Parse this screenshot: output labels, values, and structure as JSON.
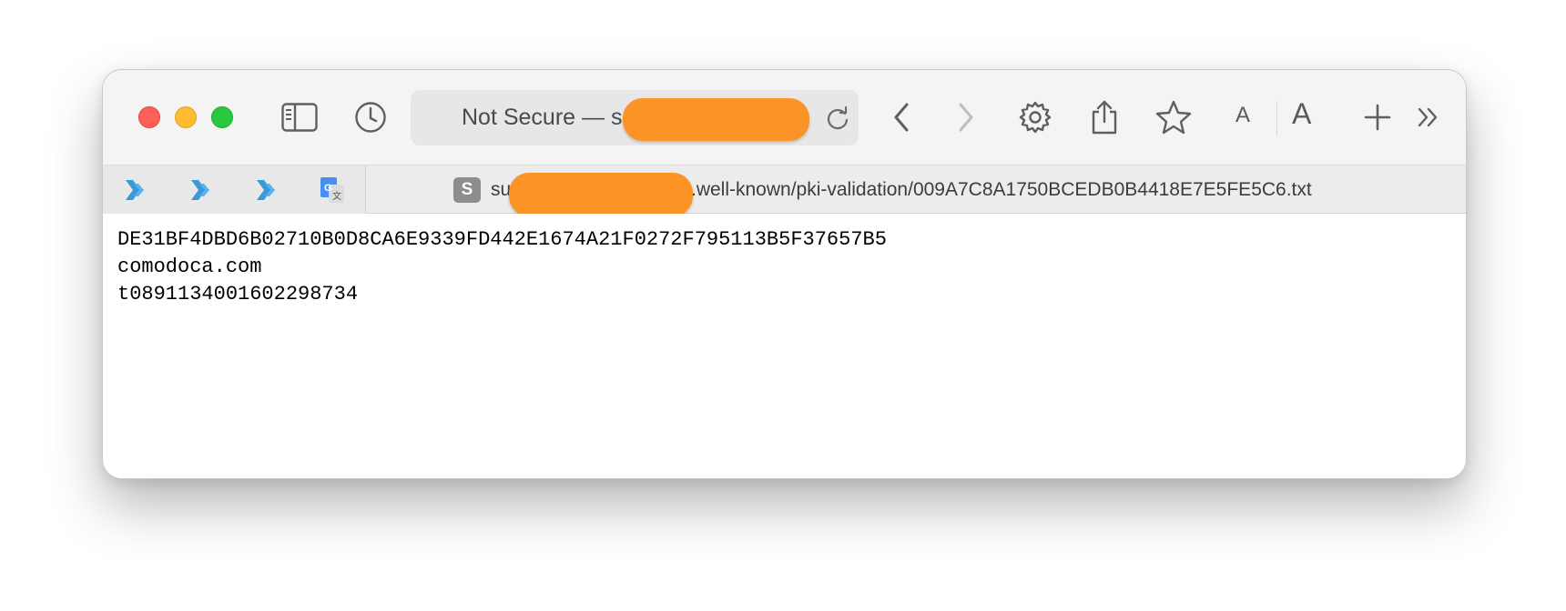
{
  "window": {
    "address_bar": {
      "text": "Not Secure — s",
      "security_label": "Not Secure"
    },
    "font_size_small_label": "A",
    "font_size_large_label": "A"
  },
  "tab": {
    "favicon_letter": "S",
    "title_start": "su",
    "title_end": ".well-known/pki-validation/009A7C8A1750BCEDB0B4418E7E5FE5C6.txt"
  },
  "icons": {
    "sidebar": "sidebar-icon",
    "history": "clock-icon",
    "reload": "reload-icon",
    "back": "chevron-left-icon",
    "forward": "chevron-right-icon",
    "settings": "gear-icon",
    "share": "share-icon",
    "bookmark": "star-icon",
    "new_tab": "plus-icon",
    "more": "double-chevron-right-icon"
  },
  "extensions": [
    {
      "name": "extension-arrow-1"
    },
    {
      "name": "extension-arrow-2"
    },
    {
      "name": "extension-arrow-3"
    },
    {
      "name": "google-translate"
    }
  ],
  "content": {
    "lines": [
      "DE31BF4DBD6B02710B0D8CA6E9339FD442E1674A21F0272F795113B5F37657B5",
      "comodoca.com",
      "t0891134001602298734"
    ]
  },
  "colors": {
    "redaction": "#fb9326",
    "extension_accent": "#3a9ad9",
    "close": "#fe5f57",
    "minimize": "#febc2e",
    "maximize": "#28c840"
  }
}
